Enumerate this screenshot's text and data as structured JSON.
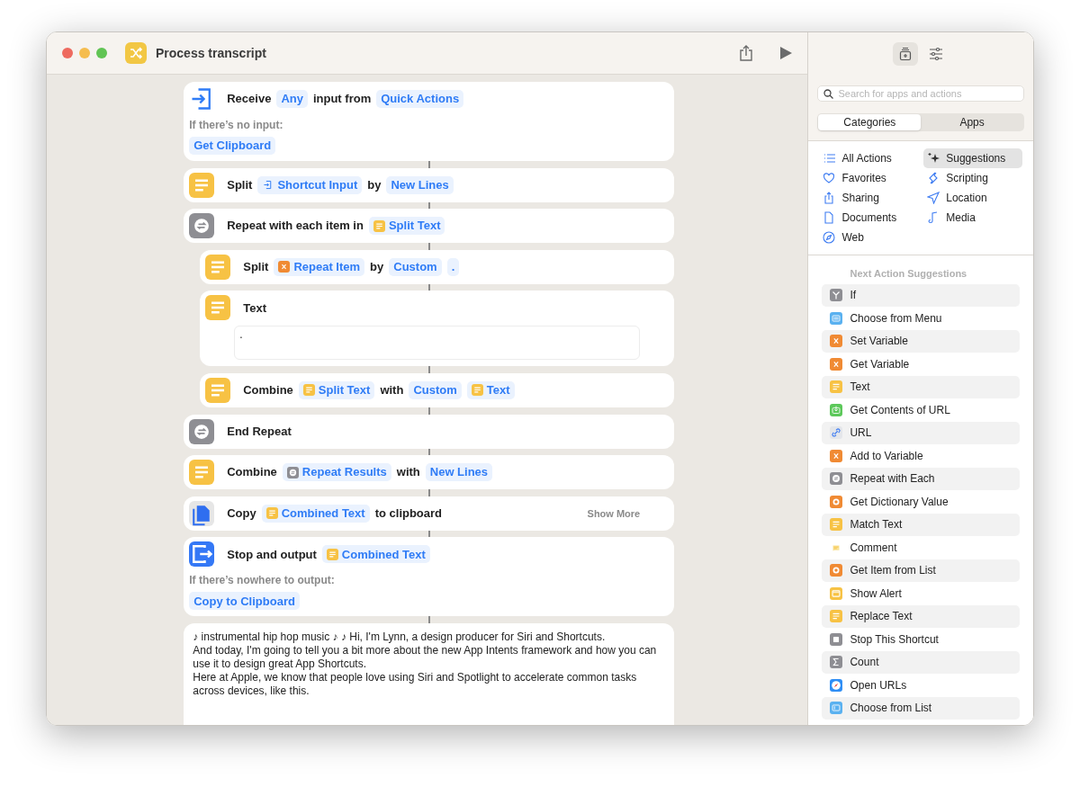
{
  "window": {
    "title": "Process transcript"
  },
  "actions": [
    {
      "kind": "receive",
      "indented": false,
      "parts": [
        {
          "kind": "word",
          "text": "Receive"
        },
        {
          "kind": "token",
          "text": "Any"
        },
        {
          "kind": "word",
          "text": "input from"
        },
        {
          "kind": "token",
          "text": "Quick Actions"
        }
      ],
      "fallback": {
        "label": "If there’s no input:",
        "value": "Get Clipboard"
      }
    },
    {
      "kind": "text",
      "indented": false,
      "parts": [
        {
          "kind": "word",
          "text": "Split"
        },
        {
          "kind": "input",
          "text": "Shortcut Input"
        },
        {
          "kind": "word",
          "text": "by"
        },
        {
          "kind": "token",
          "text": "New Lines"
        }
      ]
    },
    {
      "kind": "repeat",
      "indented": false,
      "parts": [
        {
          "kind": "word",
          "text": "Repeat with each item in"
        },
        {
          "kind": "text",
          "text": "Split Text"
        }
      ]
    },
    {
      "kind": "text",
      "indented": true,
      "parts": [
        {
          "kind": "word",
          "text": "Split"
        },
        {
          "kind": "variable",
          "text": "Repeat Item"
        },
        {
          "kind": "word",
          "text": "by"
        },
        {
          "kind": "token",
          "text": "Custom"
        },
        {
          "kind": "token",
          "text": "."
        }
      ]
    },
    {
      "kind": "text",
      "indented": true,
      "parts": [
        {
          "kind": "word",
          "text": "Text"
        }
      ],
      "text_field": "."
    },
    {
      "kind": "text",
      "indented": true,
      "parts": [
        {
          "kind": "word",
          "text": "Combine"
        },
        {
          "kind": "text",
          "text": "Split Text"
        },
        {
          "kind": "word",
          "text": "with"
        },
        {
          "kind": "token",
          "text": "Custom"
        },
        {
          "kind": "text",
          "text": "Text"
        }
      ]
    },
    {
      "kind": "repeat",
      "indented": false,
      "parts": [
        {
          "kind": "word",
          "text": "End Repeat"
        }
      ]
    },
    {
      "kind": "text",
      "indented": false,
      "parts": [
        {
          "kind": "word",
          "text": "Combine"
        },
        {
          "kind": "repeat",
          "text": "Repeat Results"
        },
        {
          "kind": "word",
          "text": "with"
        },
        {
          "kind": "token",
          "text": "New Lines"
        }
      ]
    },
    {
      "kind": "copy",
      "indented": false,
      "parts": [
        {
          "kind": "word",
          "text": "Copy"
        },
        {
          "kind": "text",
          "text": "Combined Text"
        },
        {
          "kind": "word",
          "text": "to clipboard"
        }
      ],
      "show_more": "Show More"
    },
    {
      "kind": "output",
      "indented": false,
      "parts": [
        {
          "kind": "word",
          "text": "Stop and output"
        },
        {
          "kind": "text",
          "text": "Combined Text"
        }
      ],
      "fallback": {
        "label": "If there’s nowhere to output:",
        "value": "Copy to Clipboard"
      }
    }
  ],
  "transcript": [
    "♪ instrumental hip hop music ♪ ♪ Hi, I'm Lynn, a design producer for Siri and Shortcuts.",
    "And today, I'm going to tell you a bit more about the new App Intents framework and how you can use it to design great App Shortcuts.",
    "Here at Apple, we know that people love using Siri and Spotlight to accelerate common tasks across devices, like this."
  ],
  "sidebar": {
    "toolbar": [
      {
        "kind": "library",
        "selected": true
      },
      {
        "kind": "sliders",
        "selected": false
      }
    ],
    "search": {
      "placeholder": "Search for apps and actions"
    },
    "segments": [
      {
        "label": "Categories",
        "selected": true
      },
      {
        "label": "Apps",
        "selected": false
      }
    ],
    "categories": [
      {
        "label": "All Actions",
        "kind": "list",
        "selected": false
      },
      {
        "label": "Suggestions",
        "kind": "sparkle",
        "selected": true
      },
      {
        "label": "Favorites",
        "kind": "heart",
        "selected": false
      },
      {
        "label": "Scripting",
        "kind": "scripting",
        "selected": false
      },
      {
        "label": "Sharing",
        "kind": "share",
        "selected": false
      },
      {
        "label": "Location",
        "kind": "location",
        "selected": false
      },
      {
        "label": "Documents",
        "kind": "document",
        "selected": false
      },
      {
        "label": "Media",
        "kind": "note",
        "selected": false
      },
      {
        "label": "Web",
        "kind": "compass",
        "selected": false
      }
    ],
    "suggestions_title": "Next Action Suggestions",
    "suggestions": [
      {
        "label": "If",
        "kind": "if"
      },
      {
        "label": "Choose from Menu",
        "kind": "menu"
      },
      {
        "label": "Set Variable",
        "kind": "variable"
      },
      {
        "label": "Get Variable",
        "kind": "variable"
      },
      {
        "label": "Text",
        "kind": "text"
      },
      {
        "label": "Get Contents of URL",
        "kind": "download"
      },
      {
        "label": "URL",
        "kind": "link"
      },
      {
        "label": "Add to Variable",
        "kind": "variable"
      },
      {
        "label": "Repeat with Each",
        "kind": "repeat"
      },
      {
        "label": "Get Dictionary Value",
        "kind": "dictionary"
      },
      {
        "label": "Match Text",
        "kind": "text"
      },
      {
        "label": "Comment",
        "kind": "comment"
      },
      {
        "label": "Get Item from List",
        "kind": "dictionary"
      },
      {
        "label": "Show Alert",
        "kind": "alert"
      },
      {
        "label": "Replace Text",
        "kind": "text"
      },
      {
        "label": "Stop This Shortcut",
        "kind": "stop"
      },
      {
        "label": "Count",
        "kind": "count"
      },
      {
        "label": "Open URLs",
        "kind": "safari"
      },
      {
        "label": "Choose from List",
        "kind": "listapp"
      }
    ]
  }
}
